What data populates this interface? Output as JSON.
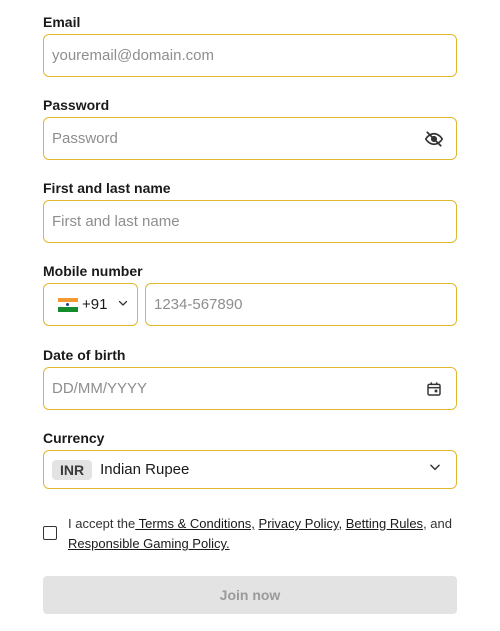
{
  "email": {
    "label": "Email",
    "placeholder": "youremail@domain.com"
  },
  "password": {
    "label": "Password",
    "placeholder": "Password",
    "toggle_icon": "eye-off-icon"
  },
  "name": {
    "label": "First and last name",
    "placeholder": "First and last name"
  },
  "mobile": {
    "label": "Mobile number",
    "country_code": "+91",
    "country_flag": "india-flag-icon",
    "placeholder": "1234-567890"
  },
  "dob": {
    "label": "Date of birth",
    "placeholder": "DD/MM/YYYY",
    "icon": "calendar-icon"
  },
  "currency": {
    "label": "Currency",
    "code": "INR",
    "name": "Indian Rupee"
  },
  "consent": {
    "prefix": "I accept the",
    "terms": " Terms & Conditions,",
    "privacy": "Privacy Policy,",
    "betting": "Betting Rules",
    "and": ", and ",
    "responsible": "Responsible Gaming Policy."
  },
  "submit": {
    "label": "Join now"
  },
  "colors": {
    "field_border": "#e0b830",
    "button_bg": "#e3e3e3",
    "button_text": "#9a9a9a"
  }
}
